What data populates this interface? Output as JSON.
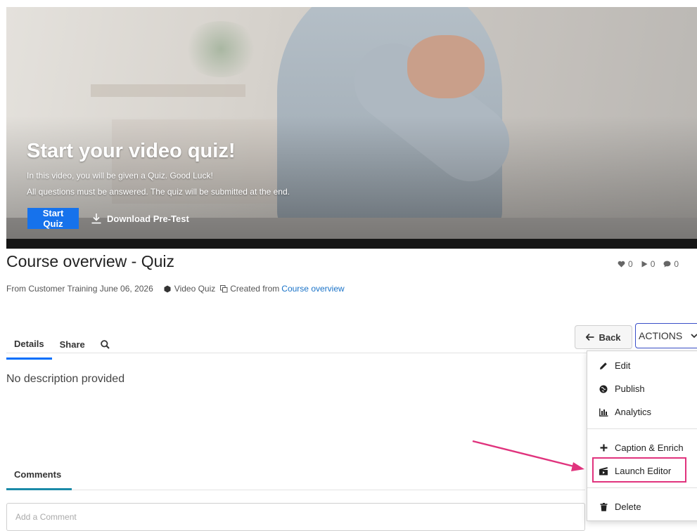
{
  "hero": {
    "title": "Start your video quiz!",
    "line1": "In this video, you will be given a Quiz. Good Luck!",
    "line2": "All questions must be answered. The quiz will be submitted at the end.",
    "start_label": "Start Quiz",
    "download_label": "Download Pre-Test"
  },
  "entry": {
    "title": "Course overview - Quiz",
    "stats": {
      "likes": "0",
      "plays": "0",
      "comments": "0"
    },
    "meta": {
      "from_text": "From Customer Training June 06, 2026",
      "type_text": "Video Quiz",
      "created_from_text": "Created from",
      "created_from_link": "Course overview"
    },
    "description": "No description provided"
  },
  "tabs": [
    {
      "label": "Details"
    },
    {
      "label": "Share"
    }
  ],
  "buttons": {
    "back_label": "Back",
    "actions_label": "ACTIONS"
  },
  "actions_menu": [
    {
      "label": "Edit",
      "icon": "pencil-icon"
    },
    {
      "label": "Publish",
      "icon": "globe-icon"
    },
    {
      "label": "Analytics",
      "icon": "bar-chart-icon"
    },
    {
      "label": "Caption & Enrich",
      "icon": "plus-icon"
    },
    {
      "label": "Launch Editor",
      "icon": "clapperboard-icon"
    },
    {
      "label": "Delete",
      "icon": "trash-icon"
    }
  ],
  "comments": {
    "tab_label": "Comments",
    "placeholder": "Add a Comment"
  },
  "colors": {
    "primary": "#1672ec",
    "tab_underline": "#006efa",
    "highlight": "#e0337d",
    "link": "#1a73c8"
  }
}
